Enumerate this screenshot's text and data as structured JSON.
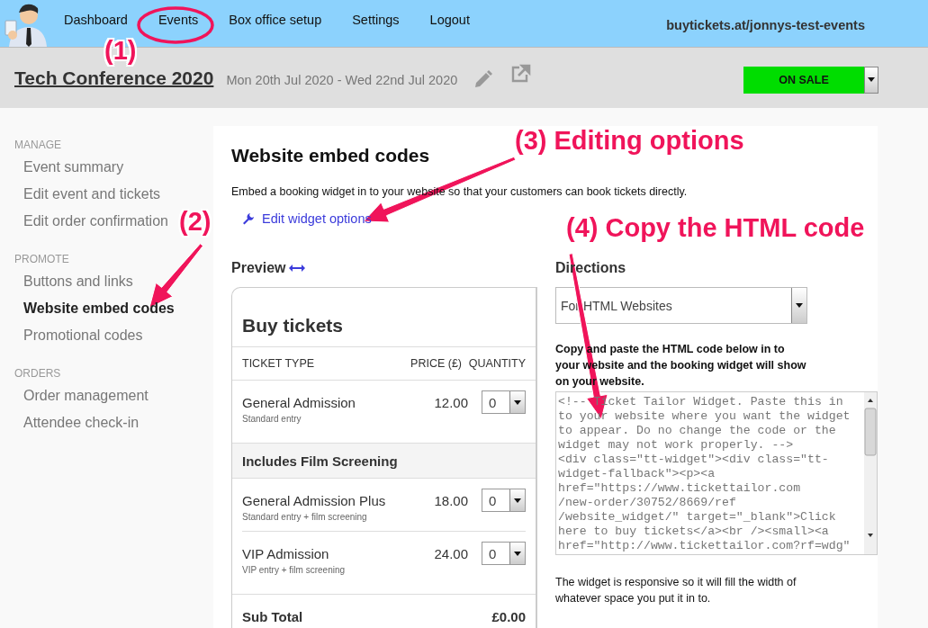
{
  "nav": {
    "items": [
      {
        "label": "Dashboard",
        "selected": false
      },
      {
        "label": "Events",
        "selected": false
      },
      {
        "label": "Box office setup",
        "selected": false
      },
      {
        "label": "Settings",
        "selected": false
      },
      {
        "label": "Logout",
        "selected": false
      }
    ],
    "url": "buytickets.at/jonnys-test-events"
  },
  "event": {
    "title": "Tech Conference 2020",
    "dates": "Mon 20th Jul 2020 - Wed 22nd Jul 2020",
    "status": "ON SALE"
  },
  "sidebar": {
    "sections": [
      {
        "heading": "MANAGE",
        "items": [
          {
            "label": "Event summary",
            "selected": false
          },
          {
            "label": "Edit event and tickets",
            "selected": false
          },
          {
            "label": "Edit order confirmation",
            "selected": false
          }
        ]
      },
      {
        "heading": "PROMOTE",
        "items": [
          {
            "label": "Buttons and links",
            "selected": false
          },
          {
            "label": "Website embed codes",
            "selected": true
          },
          {
            "label": "Promotional codes",
            "selected": false
          }
        ]
      },
      {
        "heading": "ORDERS",
        "items": [
          {
            "label": "Order management",
            "selected": false
          },
          {
            "label": "Attendee check-in",
            "selected": false
          }
        ]
      }
    ]
  },
  "main": {
    "title": "Website embed codes",
    "intro": "Embed a booking widget in to your website so that your customers can book tickets directly.",
    "edit_link": "Edit widget options",
    "preview": {
      "heading": "Preview",
      "widget": {
        "title": "Buy tickets",
        "columns": [
          "TICKET TYPE",
          "PRICE (£)",
          "QUANTITY"
        ],
        "rows": [
          {
            "kind": "ticket",
            "name": "General Admission",
            "description": "Standard entry",
            "price": "12.00",
            "quantity": "0"
          },
          {
            "kind": "group",
            "name": "Includes Film Screening"
          },
          {
            "kind": "ticket",
            "name": "General Admission Plus",
            "description": "Standard entry + film screening",
            "price": "18.00",
            "quantity": "0"
          },
          {
            "kind": "ticket",
            "name": "VIP Admission",
            "description": "VIP entry + film screening",
            "price": "24.00",
            "quantity": "0"
          }
        ],
        "subtotal_label": "Sub Total",
        "subtotal": "£0.00"
      }
    },
    "directions": {
      "heading": "Directions",
      "select": "For HTML Websites",
      "instructions": "Copy and paste the HTML code below in to your website and the booking widget will show on your website.",
      "code_lines": [
        "<!-- Ticket Tailor Widget. Paste this in",
        "to your website where you want the widget",
        "to appear. Do no change the code or the",
        "widget may not work properly. -->",
        "<div class=\"tt-widget\"><div class=\"tt-",
        "widget-fallback\"><p><a",
        "href=\"https://www.tickettailor.com",
        "/new-order/30752/8669/ref",
        "/website_widget/\" target=\"_blank\">Click",
        "here to buy tickets</a><br /><small><a",
        "href=\"http://www.tickettailor.com?rf=wdg\""
      ],
      "note": "The widget is responsive so it will fill the width of whatever space you put it in to."
    }
  },
  "callouts": [
    {
      "label": "(1)",
      "kind": "ellipse"
    },
    {
      "label": "(2)",
      "kind": "arrow"
    },
    {
      "label": "(3) Editing options",
      "kind": "arrow"
    },
    {
      "label": "(4) Copy the HTML code",
      "kind": "arrow"
    }
  ]
}
